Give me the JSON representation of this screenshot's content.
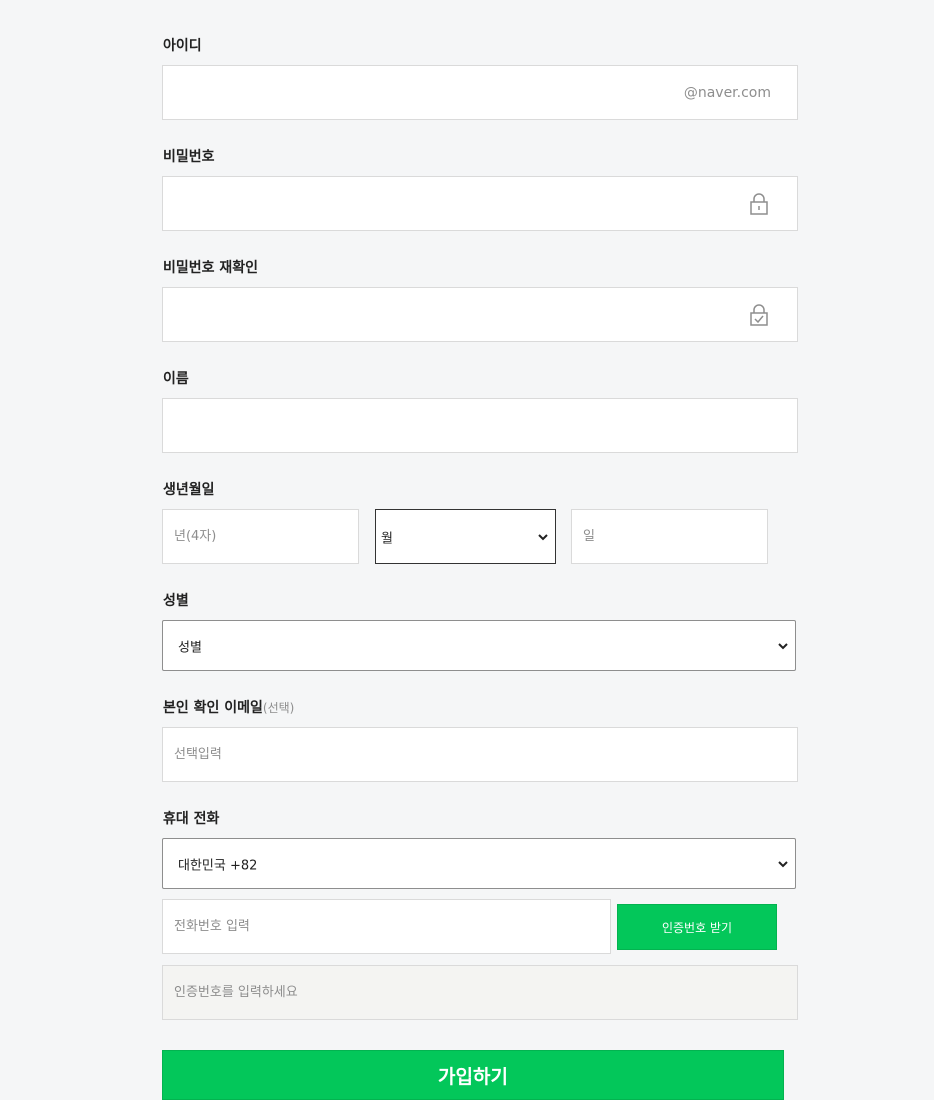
{
  "id": {
    "label": "아이디",
    "value": "",
    "suffix": "@naver.com"
  },
  "password": {
    "label": "비밀번호",
    "value": ""
  },
  "password_confirm": {
    "label": "비밀번호 재확인",
    "value": ""
  },
  "name": {
    "label": "이름",
    "value": ""
  },
  "birth": {
    "label": "생년월일",
    "year_placeholder": "년(4자)",
    "month_selected": "월",
    "day_placeholder": "일"
  },
  "gender": {
    "label": "성별",
    "selected": "성별"
  },
  "email": {
    "label": "본인 확인 이메일",
    "optional": "(선택)",
    "placeholder": "선택입력"
  },
  "phone": {
    "label": "휴대 전화",
    "country_selected": "대한민국 +82",
    "number_placeholder": "전화번호 입력",
    "verify_button": "인증번호 받기",
    "code_placeholder": "인증번호를 입력하세요"
  },
  "submit": {
    "label": "가입하기"
  },
  "colors": {
    "accent": "#03c75a",
    "background": "#f5f6f7",
    "border": "#dadada"
  }
}
